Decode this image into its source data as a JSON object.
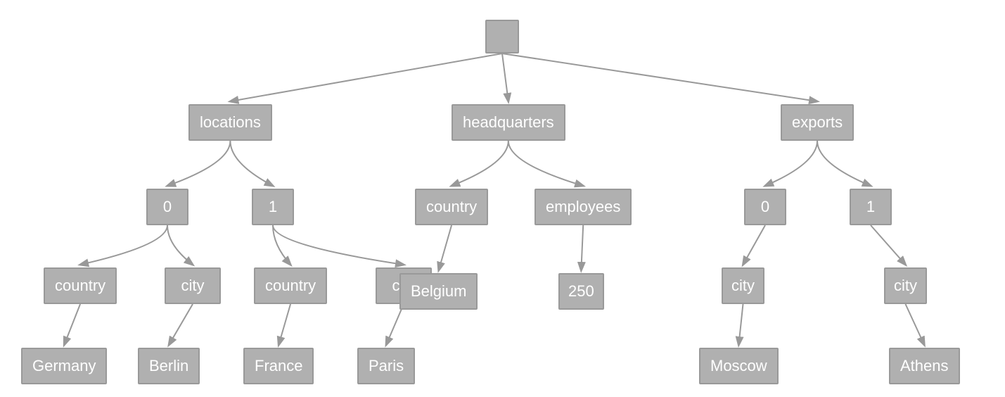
{
  "nodes": {
    "root": {
      "label": ""
    },
    "locations": {
      "label": "locations"
    },
    "headquarters": {
      "label": "headquarters"
    },
    "exports": {
      "label": "exports"
    },
    "loc_0": {
      "label": "0"
    },
    "loc_1": {
      "label": "1"
    },
    "hq_country": {
      "label": "country"
    },
    "hq_employees": {
      "label": "employees"
    },
    "exp_0": {
      "label": "0"
    },
    "exp_1": {
      "label": "1"
    },
    "loc0_country": {
      "label": "country"
    },
    "loc0_city": {
      "label": "city"
    },
    "loc1_country": {
      "label": "country"
    },
    "loc1_city": {
      "label": "city"
    },
    "hq_belgium": {
      "label": "Belgium"
    },
    "hq_250": {
      "label": "250"
    },
    "exp0_city": {
      "label": "city"
    },
    "exp1_city": {
      "label": "city"
    },
    "loc0_germany": {
      "label": "Germany"
    },
    "loc0_berlin": {
      "label": "Berlin"
    },
    "loc1_france": {
      "label": "France"
    },
    "loc1_paris": {
      "label": "Paris"
    },
    "exp0_moscow": {
      "label": "Moscow"
    },
    "exp1_athens": {
      "label": "Athens"
    }
  }
}
